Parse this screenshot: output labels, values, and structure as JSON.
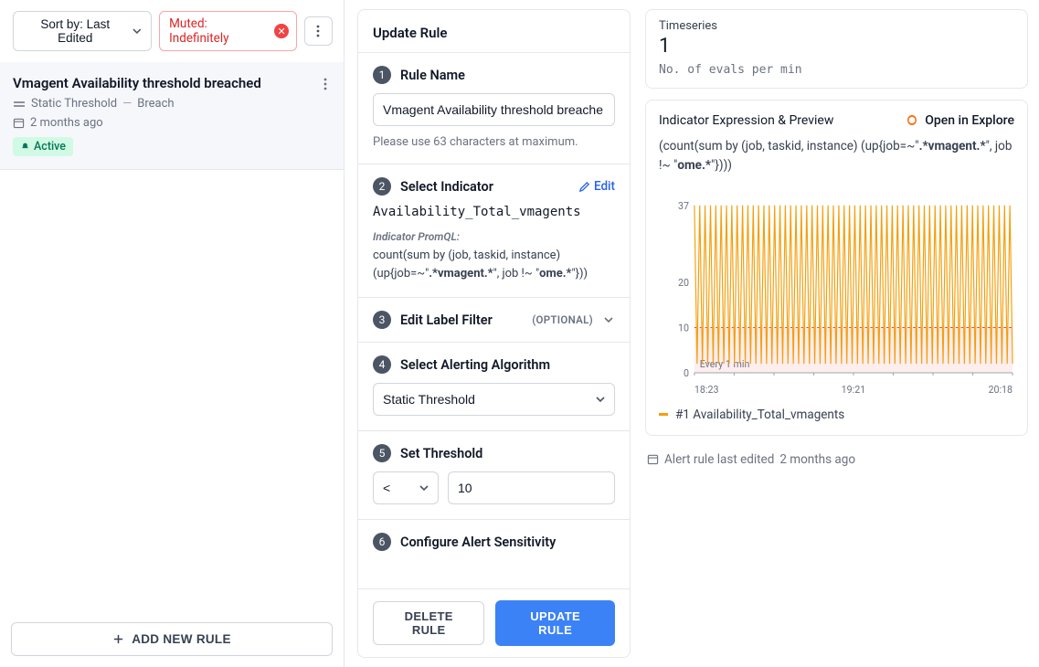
{
  "sidebar": {
    "sort_label": "Sort by: Last Edited",
    "mute_label": "Muted: Indefinitely",
    "add_rule_label": "ADD NEW RULE",
    "rule": {
      "title": "Vmagent Availability threshold breached",
      "type": "Static Threshold",
      "mode": "Breach",
      "age": "2 months ago",
      "status": "Active"
    }
  },
  "form": {
    "title": "Update Rule",
    "step1": {
      "num": "1",
      "title": "Rule Name",
      "value": "Vmagent Availability threshold breache",
      "helper": "Please use 63 characters at maximum."
    },
    "step2": {
      "num": "2",
      "title": "Select Indicator",
      "edit": "Edit",
      "indicator": "Availability_Total_vmagents",
      "promql_label": "Indicator PromQL:",
      "promql_prefix": "count(sum by (job, taskid, instance) (up{job=~\"",
      "promql_bold1": ".*vmagent.*",
      "promql_mid": "\", job !~ \"",
      "promql_bold2": "ome.*",
      "promql_suffix": "\"}))"
    },
    "step3": {
      "num": "3",
      "title": "Edit Label Filter",
      "tag": "(OPTIONAL)"
    },
    "step4": {
      "num": "4",
      "title": "Select Alerting Algorithm",
      "value": "Static Threshold"
    },
    "step5": {
      "num": "5",
      "title": "Set Threshold",
      "operator": "<",
      "value": "10"
    },
    "step6": {
      "num": "6",
      "title": "Configure Alert Sensitivity"
    },
    "delete_label": "DELETE RULE",
    "update_label": "UPDATE RULE"
  },
  "right": {
    "ts_label": "Timeseries",
    "ts_value": "1",
    "ts_hint": "No. of evals per min",
    "preview_title": "Indicator Expression & Preview",
    "open_label": "Open in Explore",
    "expr_prefix": "(count(sum by (job, taskid, instance) (up{job=~\"",
    "expr_bold1": ".*vmagent.*",
    "expr_mid": "\", job !~ \"",
    "expr_bold2": "ome.*",
    "expr_suffix": "\"})))",
    "chart_note": "Every 1 min",
    "legend": "#1 Availability_Total_vmagents",
    "edited_prefix": "Alert rule last edited",
    "edited_age": "2 months ago"
  },
  "chart_data": {
    "type": "line",
    "y_ticks": [
      0,
      10,
      20,
      37
    ],
    "ylim": [
      0,
      40
    ],
    "x_ticks": [
      "18:23",
      "19:21",
      "20:18"
    ],
    "threshold": 10,
    "series": [
      {
        "name": "#1 Availability_Total_vmagents",
        "color": "#f59e0b",
        "values": [
          37,
          2,
          37,
          2,
          37,
          2,
          37,
          2,
          37,
          2,
          37,
          2,
          37,
          2,
          37,
          2,
          37,
          2,
          37,
          2,
          37,
          2,
          37,
          2,
          37,
          2,
          37,
          2,
          37,
          2,
          37,
          2,
          37,
          2,
          37,
          2,
          37,
          2,
          37,
          2,
          37,
          2,
          37,
          2,
          37,
          2,
          37,
          2,
          37,
          2,
          37,
          2,
          37,
          2,
          37,
          2,
          37,
          2,
          37,
          2,
          37,
          2,
          37,
          2,
          37,
          2,
          37,
          2,
          37,
          2,
          37,
          2,
          37,
          2,
          37,
          2,
          37,
          2,
          37,
          2,
          37,
          2,
          37,
          2,
          37,
          2,
          37,
          2,
          37,
          2,
          37,
          2,
          37,
          2,
          37,
          2,
          37,
          2,
          37,
          2,
          37,
          2,
          37,
          2,
          37,
          2,
          37,
          2,
          37,
          2,
          37,
          2,
          37,
          2,
          37,
          2,
          37,
          2,
          37,
          2
        ]
      }
    ]
  }
}
